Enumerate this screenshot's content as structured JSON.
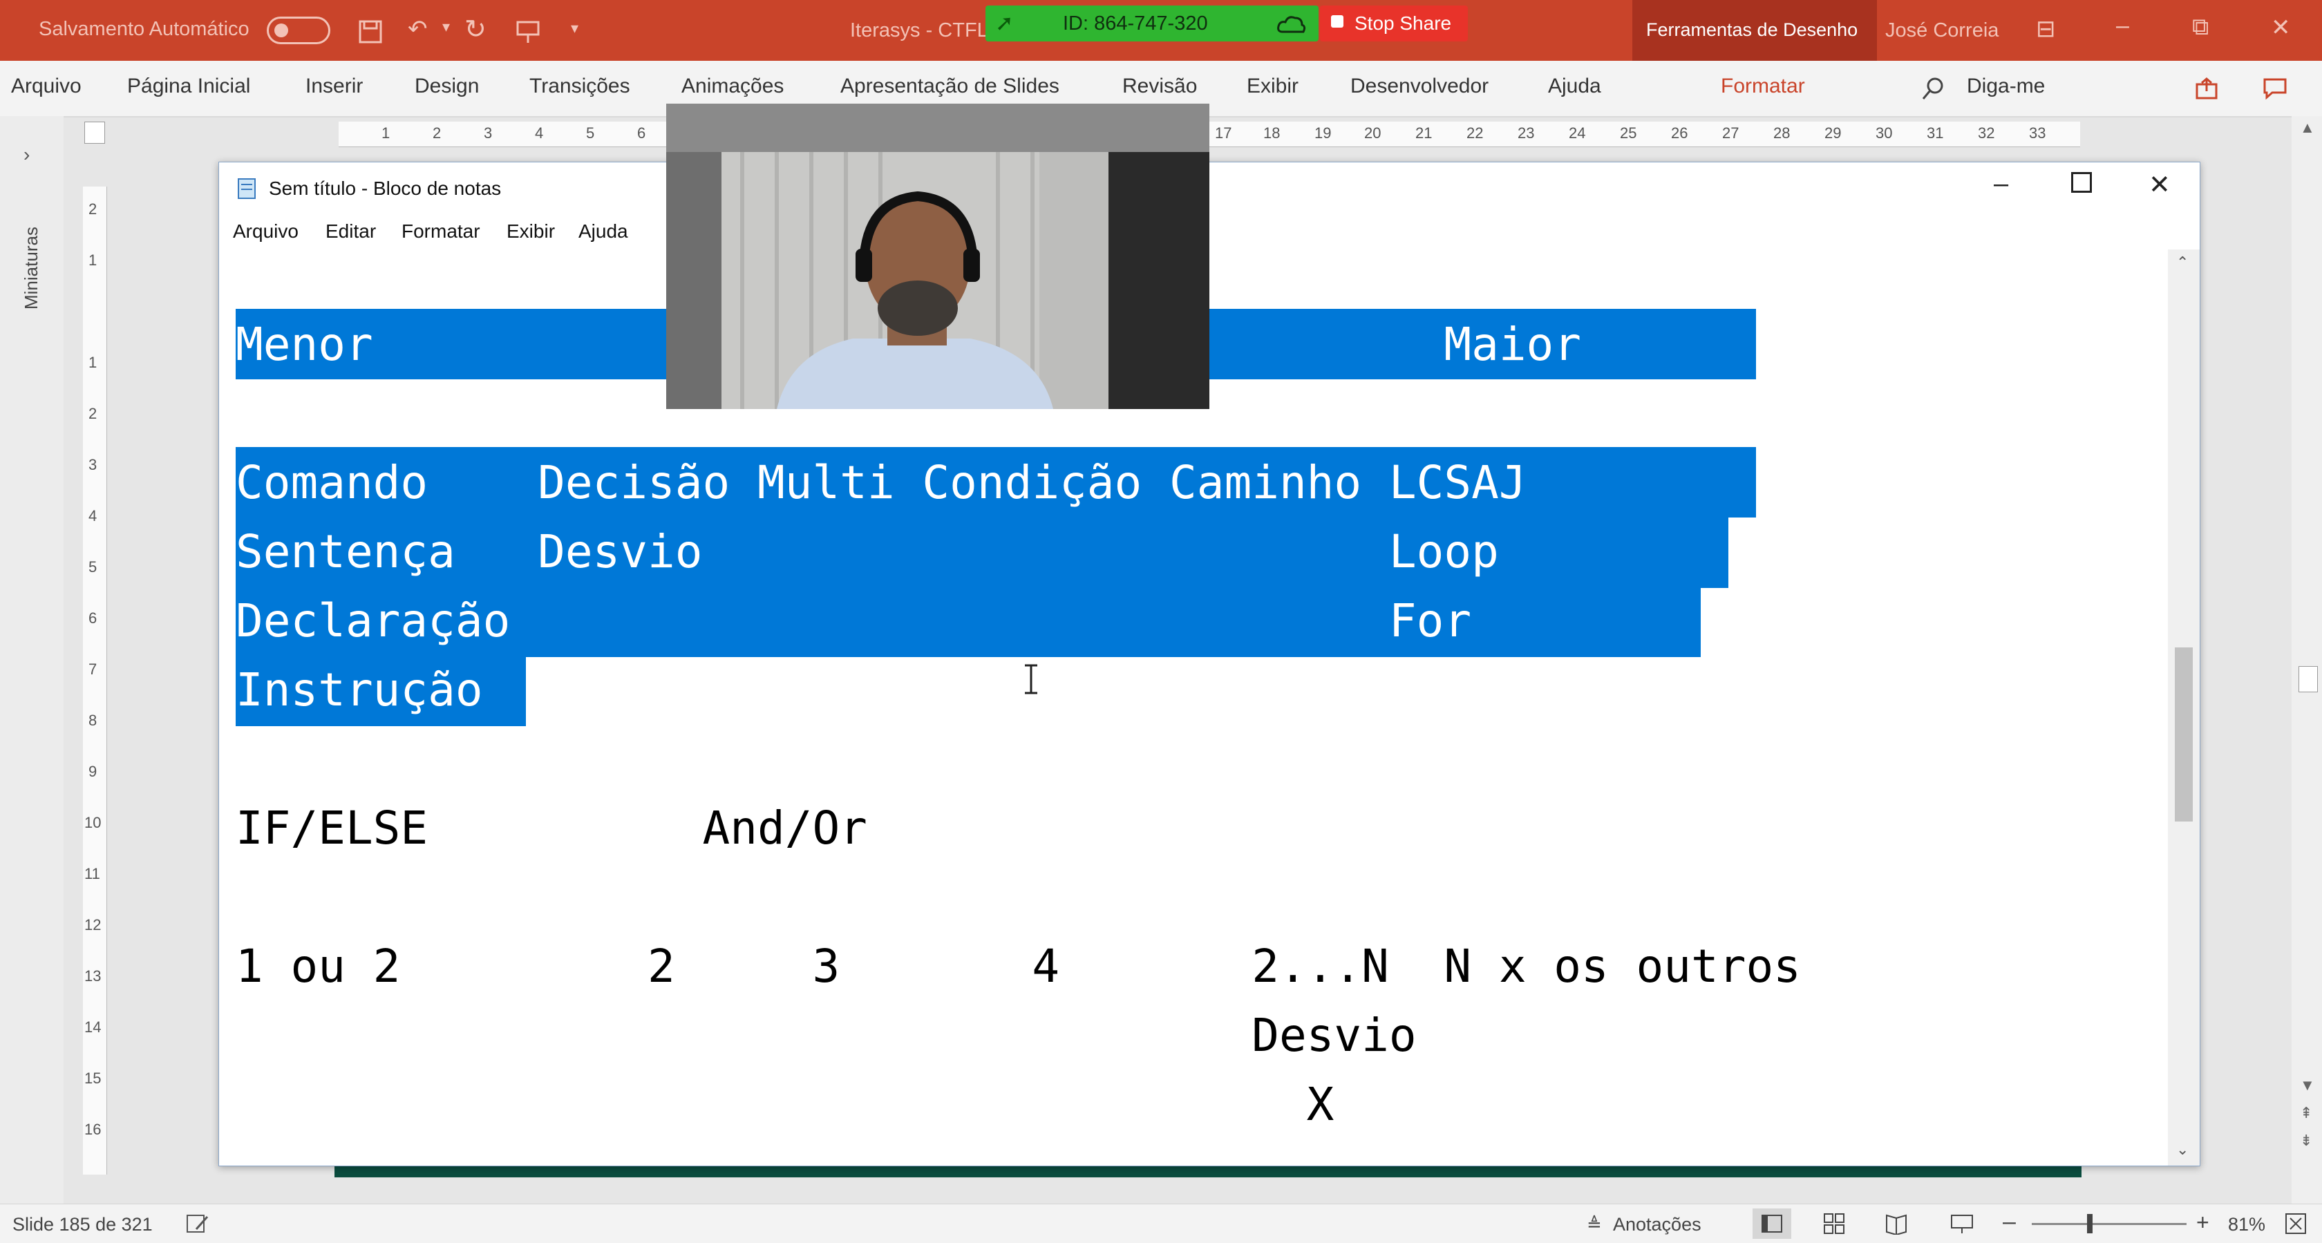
{
  "titlebar": {
    "autosave_label": "Salvamento Automático",
    "doc_title": "Iterasys - CTFL",
    "tools_tab": "Ferramentas de Desenho",
    "user": "José Correia"
  },
  "share_bar": {
    "id_label": "ID: 864-747-320",
    "stop_label": "Stop Share"
  },
  "ribbon": {
    "tabs": [
      "Arquivo",
      "Página Inicial",
      "Inserir",
      "Design",
      "Transições",
      "Animações",
      "Apresentação de Slides",
      "Revisão",
      "Exibir",
      "Desenvolvedor",
      "Ajuda"
    ],
    "format_tab": "Formatar",
    "tell_me": "Diga-me"
  },
  "thumbnails_label": "Miniaturas",
  "ruler": {
    "h_numbers": [
      "1",
      "2",
      "3",
      "4",
      "5",
      "6",
      "17",
      "18",
      "19",
      "20",
      "21",
      "22",
      "23",
      "24",
      "25",
      "26",
      "27",
      "28",
      "29",
      "30",
      "31",
      "32",
      "33"
    ],
    "v_numbers": [
      "2",
      "1",
      "1",
      "2",
      "3",
      "4",
      "5",
      "6",
      "7",
      "8",
      "9",
      "10",
      "11",
      "12",
      "13",
      "14",
      "15",
      "16"
    ]
  },
  "notepad": {
    "title": "Sem título - Bloco de notas",
    "menu": [
      "Arquivo",
      "Editar",
      "Formatar",
      "Exibir",
      "Ajuda"
    ],
    "selected_lines": [
      "Menor                                       Maior",
      "",
      "Comando    Decisão Multi Condição Caminho LCSAJ",
      "Sentença   Desvio                         Loop",
      "Declaração                                For",
      "Instrução"
    ],
    "lines": [
      "",
      "IF/ELSE          And/Or",
      "",
      "1 ou 2         2     3       4       2...N  N x os outros",
      "                                     Desvio",
      "                                       X"
    ],
    "selection_color": "#0078d7"
  },
  "statusbar": {
    "slide_info": "Slide 185 de 321",
    "notes": "Anotações",
    "zoom": "81%"
  }
}
